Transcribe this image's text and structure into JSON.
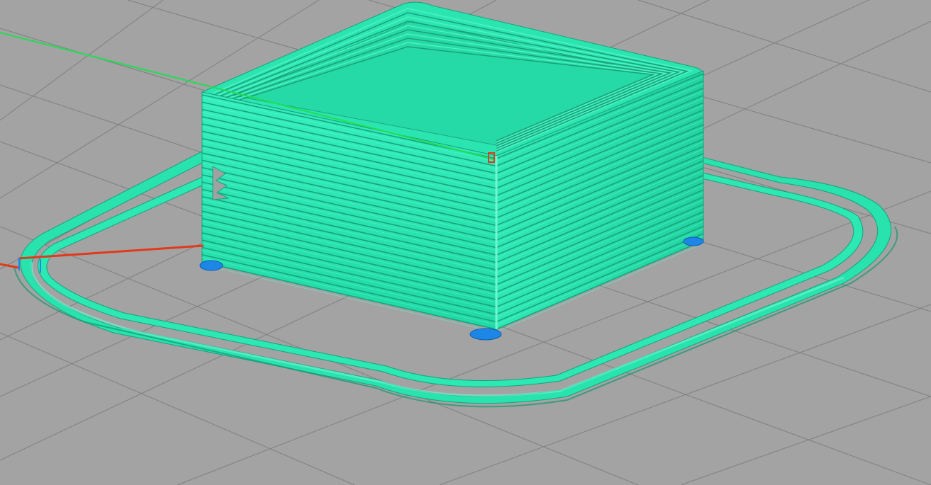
{
  "app": {
    "view": "gcode-preview-3d"
  },
  "colors": {
    "background": "#a3a3a3",
    "grid_line": "#7f7f7f",
    "extrusion": "#27e6b0",
    "extrusion_shade": "#1b9f7a",
    "extrusion_highlight": "#5ff5cf",
    "travel_move": "#22dd55",
    "retraction_move": "#e03a1a",
    "seam_marker": "#1e86e6"
  },
  "icons": {
    "seam": "seam-marker-icon"
  }
}
